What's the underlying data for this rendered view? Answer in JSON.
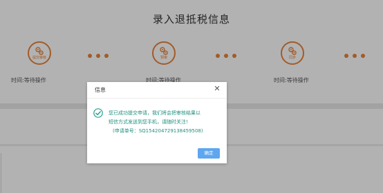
{
  "page": {
    "title": "录入退抵税信息"
  },
  "steps": [
    {
      "label": "提交审核",
      "time": "时间:等待操作",
      "icon": "gears-icon"
    },
    {
      "label": "预审",
      "time": "时间:等待操作",
      "icon": "gears-icon"
    },
    {
      "label": "同步",
      "time": "时间:等待操作",
      "icon": "gears-icon"
    }
  ],
  "dialog": {
    "title": "信息",
    "message_line1": "您已成功提交申请，我们将会把审核结果以",
    "message_line2": "短信方式发送到您手机，请随时关注!",
    "order_line": "(申请单号：SQ154204729138459508)",
    "ok_label": "确定",
    "close_symbol": "✕"
  },
  "colors": {
    "accent": "#e8833a",
    "success": "#1f8f7d",
    "button": "#5ea6ef"
  }
}
